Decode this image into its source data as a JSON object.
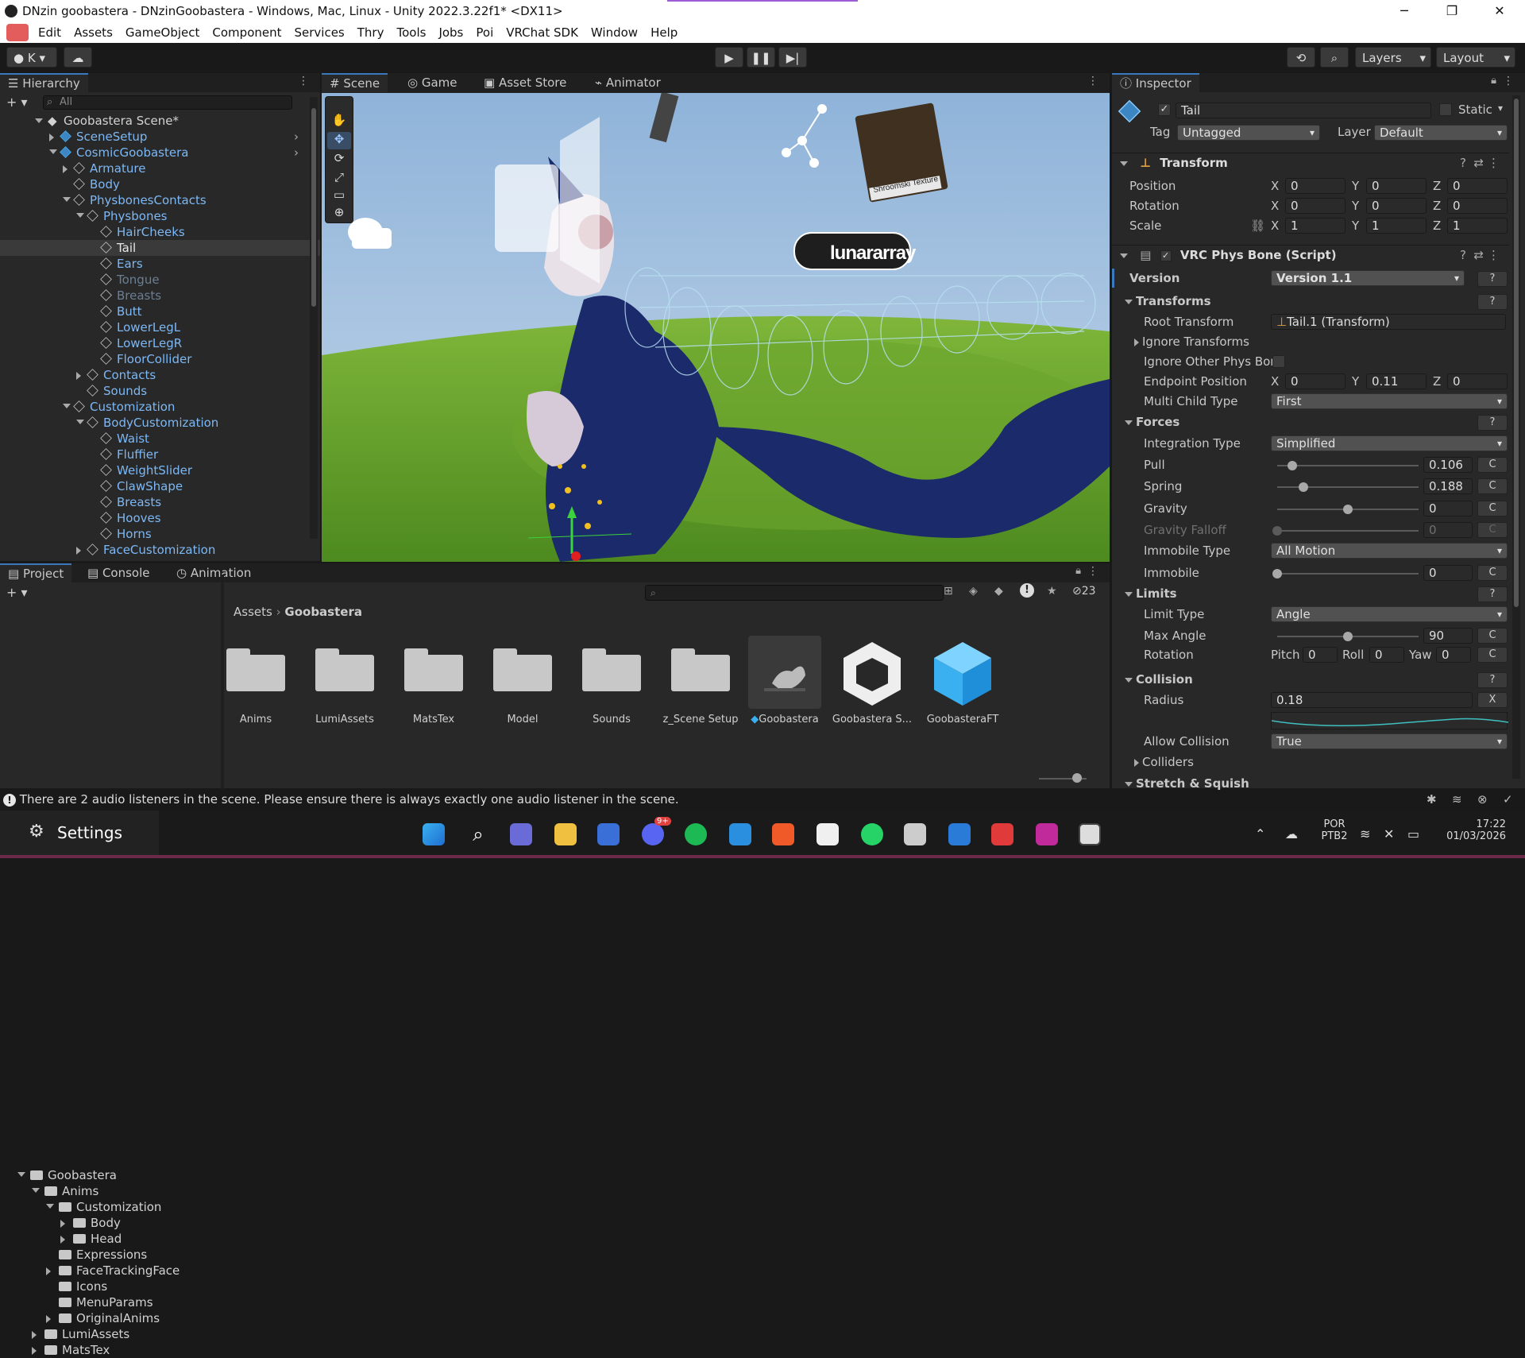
{
  "window": {
    "title": "DNzin goobastera - DNzinGoobastera - Windows, Mac, Linux - Unity 2022.3.22f1* <DX11>"
  },
  "menubar": [
    "Edit",
    "Assets",
    "GameObject",
    "Component",
    "Services",
    "Thry",
    "Tools",
    "Jobs",
    "Poi",
    "VRChat SDK",
    "Window",
    "Help"
  ],
  "toolbar": {
    "account_label": "K",
    "layers_label": "Layers",
    "layout_label": "Layout"
  },
  "hierarchy": {
    "tab": "Hierarchy",
    "search_placeholder": "All",
    "scene_name": "Goobastera Scene*",
    "items": [
      {
        "label": "SceneSetup",
        "indent": 1,
        "style": "blue"
      },
      {
        "label": "CosmicGoobastera",
        "indent": 1,
        "style": "blue"
      },
      {
        "label": "Armature",
        "indent": 2,
        "style": "normal"
      },
      {
        "label": "Body",
        "indent": 2,
        "style": "normal"
      },
      {
        "label": "PhysbonesContacts",
        "indent": 2,
        "style": "normal"
      },
      {
        "label": "Physbones",
        "indent": 3,
        "style": "normal"
      },
      {
        "label": "HairCheeks",
        "indent": 4,
        "style": "normal"
      },
      {
        "label": "Tail",
        "indent": 4,
        "style": "selected"
      },
      {
        "label": "Ears",
        "indent": 4,
        "style": "normal"
      },
      {
        "label": "Tongue",
        "indent": 4,
        "style": "dim"
      },
      {
        "label": "Breasts",
        "indent": 4,
        "style": "dim"
      },
      {
        "label": "Butt",
        "indent": 4,
        "style": "normal"
      },
      {
        "label": "LowerLegL",
        "indent": 4,
        "style": "normal"
      },
      {
        "label": "LowerLegR",
        "indent": 4,
        "style": "normal"
      },
      {
        "label": "FloorCollider",
        "indent": 4,
        "style": "normal"
      },
      {
        "label": "Contacts",
        "indent": 3,
        "style": "normal"
      },
      {
        "label": "Sounds",
        "indent": 3,
        "style": "normal"
      },
      {
        "label": "Customization",
        "indent": 2,
        "style": "normal"
      },
      {
        "label": "BodyCustomization",
        "indent": 3,
        "style": "normal"
      },
      {
        "label": "Waist",
        "indent": 4,
        "style": "normal"
      },
      {
        "label": "Fluffier",
        "indent": 4,
        "style": "normal"
      },
      {
        "label": "WeightSlider",
        "indent": 4,
        "style": "normal"
      },
      {
        "label": "ClawShape",
        "indent": 4,
        "style": "normal"
      },
      {
        "label": "Breasts",
        "indent": 4,
        "style": "normal"
      },
      {
        "label": "Hooves",
        "indent": 4,
        "style": "normal"
      },
      {
        "label": "Horns",
        "indent": 4,
        "style": "normal"
      },
      {
        "label": "FaceCustomization",
        "indent": 3,
        "style": "normal"
      }
    ]
  },
  "scene_tabs": [
    "Scene",
    "Game",
    "Asset Store",
    "Animator"
  ],
  "scene": {
    "logo_text": "lunararray",
    "poster_text": "Shroomski Texture"
  },
  "inspector": {
    "tab": "Inspector",
    "object_name": "Tail",
    "static_label": "Static",
    "tag_label": "Tag",
    "tag_value": "Untagged",
    "layer_label": "Layer",
    "layer_value": "Default",
    "transform": {
      "title": "Transform",
      "position_label": "Position",
      "rotation_label": "Rotation",
      "scale_label": "Scale",
      "position": [
        "0",
        "0",
        "0"
      ],
      "rotation": [
        "0",
        "0",
        "0"
      ],
      "scale": [
        "1",
        "1",
        "1"
      ]
    },
    "physbone": {
      "title": "VRC Phys Bone (Script)",
      "version_label": "Version",
      "version_value": "Version 1.1",
      "transforms_section": "Transforms",
      "root_transform_label": "Root Transform",
      "root_transform_value": "Tail.1 (Transform)",
      "ignore_transforms_label": "Ignore Transforms",
      "ignore_other_label": "Ignore Other Phys Bor",
      "endpoint_label": "Endpoint Position",
      "endpoint": [
        "0",
        "0.11",
        "0"
      ],
      "multi_child_label": "Multi Child Type",
      "multi_child_value": "First",
      "forces_section": "Forces",
      "integration_label": "Integration Type",
      "integration_value": "Simplified",
      "pull_label": "Pull",
      "pull_value": "0.106",
      "spring_label": "Spring",
      "spring_value": "0.188",
      "gravity_label": "Gravity",
      "gravity_value": "0",
      "gravity_falloff_label": "Gravity Falloff",
      "gravity_falloff_value": "0",
      "immobile_type_label": "Immobile Type",
      "immobile_type_value": "All Motion",
      "immobile_label": "Immobile",
      "immobile_value": "0",
      "limits_section": "Limits",
      "limit_type_label": "Limit Type",
      "limit_type_value": "Angle",
      "max_angle_label": "Max Angle",
      "max_angle_value": "90",
      "rotation_label": "Rotation",
      "pitch_label": "Pitch",
      "pitch_value": "0",
      "roll_label": "Roll",
      "roll_value": "0",
      "yaw_label": "Yaw",
      "yaw_value": "0",
      "collision_section": "Collision",
      "radius_label": "Radius",
      "radius_value": "0.18",
      "allow_collision_label": "Allow Collision",
      "allow_collision_value": "True",
      "colliders_label": "Colliders",
      "stretch_section": "Stretch & Squish"
    }
  },
  "project": {
    "tabs": [
      "Project",
      "Console",
      "Animation"
    ],
    "hidden_count": "23",
    "breadcrumb": [
      "Assets",
      "Goobastera"
    ],
    "tree": [
      {
        "label": "Goobastera",
        "indent": 0
      },
      {
        "label": "Anims",
        "indent": 1
      },
      {
        "label": "Customization",
        "indent": 2
      },
      {
        "label": "Body",
        "indent": 3
      },
      {
        "label": "Head",
        "indent": 3
      },
      {
        "label": "Expressions",
        "indent": 2
      },
      {
        "label": "FaceTrackingFace",
        "indent": 2
      },
      {
        "label": "Icons",
        "indent": 2
      },
      {
        "label": "MenuParams",
        "indent": 2
      },
      {
        "label": "OriginalAnims",
        "indent": 2
      },
      {
        "label": "LumiAssets",
        "indent": 1
      },
      {
        "label": "MatsTex",
        "indent": 1
      }
    ],
    "assets": [
      "Anims",
      "LumiAssets",
      "MatsTex",
      "Model",
      "Sounds",
      "z_Scene Setup",
      "Goobastera",
      "Goobastera S...",
      "GoobasteraFT"
    ]
  },
  "status": {
    "message": "There are 2 audio listeners in the scene. Please ensure there is always exactly one audio listener in the scene."
  },
  "taskbar": {
    "settings_label": "Settings",
    "lang_1": "POR",
    "lang_2": "PTB2",
    "time": "17:22",
    "date": "01/03/2026",
    "discord_badge": "9+"
  },
  "colors": {
    "accent": "#3a79bb",
    "panel_bg": "#282828",
    "blue_text": "#7cb8f5"
  }
}
